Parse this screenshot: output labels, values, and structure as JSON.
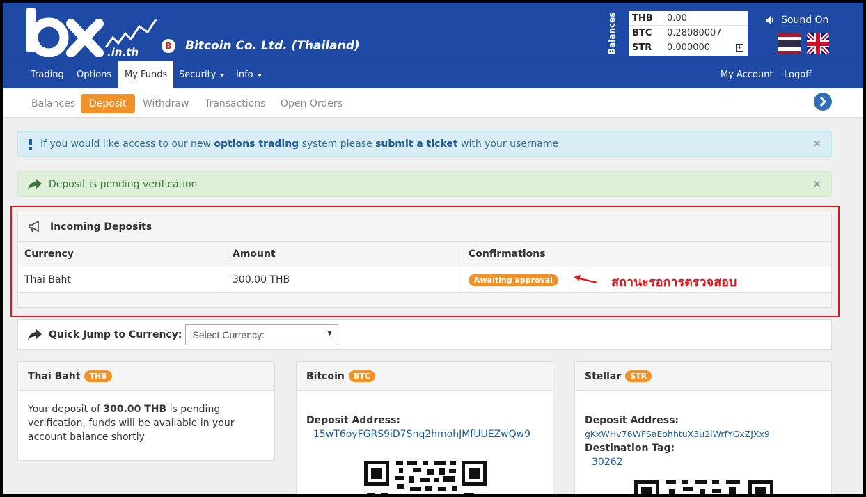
{
  "header": {
    "company_name": "Bitcoin Co. Ltd. (Thailand)",
    "company_icon": "B",
    "balances_label": "Balances",
    "balances": [
      {
        "currency": "THB",
        "value": "0.00"
      },
      {
        "currency": "BTC",
        "value": "0.28080007"
      },
      {
        "currency": "STR",
        "value": "0.000000"
      }
    ],
    "expand_symbol": "+",
    "sound_label": "Sound On"
  },
  "nav": {
    "trading": "Trading",
    "options": "Options",
    "my_funds": "My Funds",
    "security": "Security",
    "info": "Info",
    "my_account": "My Account",
    "logoff": "Logoff"
  },
  "subnav": {
    "balances": "Balances",
    "deposit": "Deposit",
    "withdraw": "Withdraw",
    "transactions": "Transactions",
    "open_orders": "Open Orders"
  },
  "alerts": {
    "info_prefix": "If you would like access to our new",
    "info_link1": "options trading",
    "info_middle": "system please",
    "info_link2": "submit a ticket",
    "info_suffix": "with your username",
    "success": "Deposit is pending verification",
    "close": "×"
  },
  "incoming": {
    "title": "Incoming Deposits",
    "columns": [
      "Currency",
      "Amount",
      "Confirmations"
    ],
    "rows": [
      {
        "currency": "Thai Baht",
        "amount": "300.00 THB",
        "status": "Awaiting approval"
      }
    ],
    "annotation": "สถานะรอการตรวจสอบ"
  },
  "quick_jump": {
    "label": "Quick Jump to Currency:",
    "select_value": "Select Currency:"
  },
  "panels": {
    "thb": {
      "name": "Thai Baht",
      "code": "THB",
      "msg_prefix": "Your deposit of",
      "msg_amount": "300.00 THB",
      "msg_suffix": "is pending verification, funds will be available in your account balance shortly"
    },
    "btc": {
      "name": "Bitcoin",
      "code": "BTC",
      "address_label": "Deposit Address:",
      "address": "15wT6oyFGRS9iD7Snq2hmohJMfUUEZwQw9"
    },
    "str": {
      "name": "Stellar",
      "code": "STR",
      "address_label": "Deposit Address:",
      "address": "gKxWHv76WFSaEohhtuX3u2iWrfYGxZJXx9",
      "tag_label": "Destination Tag:",
      "tag": "30262"
    }
  },
  "colors": {
    "brand_blue": "#1e4aa6",
    "accent_orange": "#f0922a",
    "annotation_red": "#e0141a",
    "link_blue": "#1b5c9e"
  }
}
